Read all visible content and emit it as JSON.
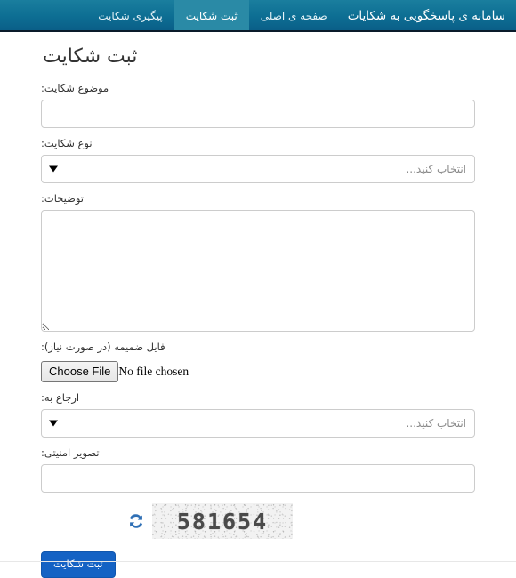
{
  "navbar": {
    "brand": "سامانه ی پاسخگویی به شکایات",
    "items": [
      {
        "label": "صفحه ی اصلی",
        "active": false
      },
      {
        "label": "ثبت شکایت",
        "active": true
      },
      {
        "label": "پیگیری شکایت",
        "active": false
      }
    ],
    "active_color": "#2a8aa6",
    "background_color": "#0d6e93"
  },
  "page": {
    "title": "ثبت شکایت"
  },
  "form": {
    "subject": {
      "label": "موضوع شکایت:",
      "value": "",
      "placeholder": ""
    },
    "type": {
      "label": "نوع شکایت:",
      "selected": "انتخاب کنید...",
      "options": [
        "انتخاب کنید..."
      ]
    },
    "description": {
      "label": "توضیحات:",
      "value": "",
      "placeholder": ""
    },
    "attachment": {
      "label": "فایل ضمیمه (در صورت نیاز):",
      "button_label": "Choose File",
      "status_text": "No file chosen"
    },
    "refer_to": {
      "label": "ارجاع به:",
      "selected": "انتخاب کنید...",
      "options": [
        "انتخاب کنید..."
      ]
    },
    "captcha": {
      "label": "تصویر امنیتی:",
      "value": "",
      "placeholder": "",
      "image_text": "581654",
      "refresh_icon": "refresh-icon",
      "refresh_icon_color": "#2f6fb5"
    },
    "submit": {
      "label": "ثبت شکایت",
      "color": "#1462c4"
    }
  }
}
